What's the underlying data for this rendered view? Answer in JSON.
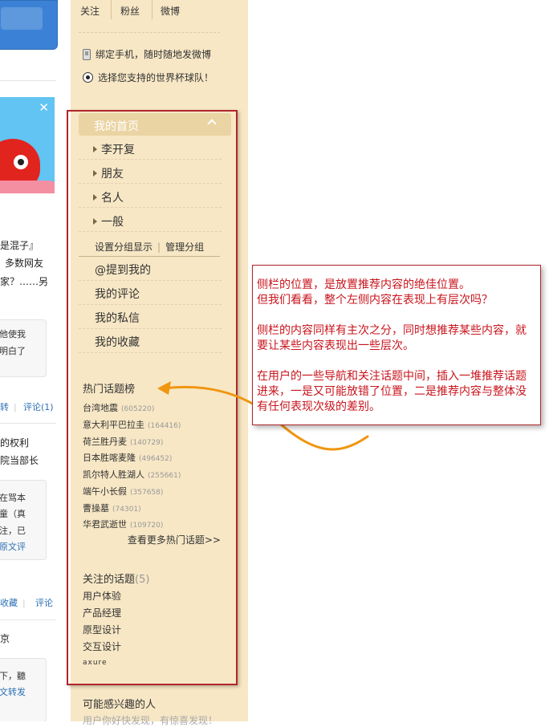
{
  "stats": [
    "关注",
    "粉丝",
    "微博"
  ],
  "promos": {
    "bind_phone": "绑定手机，随时随地发微博",
    "worldcup": "选择您支持的世界杯球队！"
  },
  "menu": {
    "home": "我的首页",
    "groups": [
      "李开复",
      "朋友",
      "名人",
      "一般"
    ],
    "group_settings": "设置分组显示",
    "manage_groups": "管理分组",
    "nav": [
      "@提到我的",
      "我的评论",
      "我的私信",
      "我的收藏"
    ]
  },
  "hot_topics": {
    "title": "热门话题榜",
    "items": [
      {
        "name": "台湾地震",
        "count": "(605220)"
      },
      {
        "name": "意大利平巴拉圭",
        "count": "(164416)"
      },
      {
        "name": "荷兰胜丹麦",
        "count": "(140729)"
      },
      {
        "name": "日本胜喀麦隆",
        "count": "(496452)"
      },
      {
        "name": "凯尔特人胜湖人",
        "count": "(255661)"
      },
      {
        "name": "端午小长假",
        "count": "(357658)"
      },
      {
        "name": "曹操墓",
        "count": "(74301)"
      },
      {
        "name": "华君武逝世",
        "count": "(109720)"
      }
    ],
    "more": "查看更多热门话题>>"
  },
  "followed_topics": {
    "title": "关注的话题",
    "count": "(5)",
    "items": [
      "用户体验",
      "产品经理",
      "原型设计",
      "交互设计",
      "axure"
    ]
  },
  "interest": {
    "title": "可能感兴趣的人",
    "cutoff": "用户你好快发现，有惊喜发现！"
  },
  "feed": {
    "frag1": "是混子』",
    "frag2": "多数网友",
    "frag3": "家？……另",
    "frag4": "他使我",
    "frag5": "明白了",
    "action1": "转",
    "action1b": "评论(1)",
    "frag6": "的权利",
    "frag7": "院当部长",
    "frag8": "在骂本",
    "frag9": "童（真",
    "frag10": "注，已",
    "frag11": "原文评",
    "action2a": "收藏",
    "action2b": "评论",
    "frag12": "京",
    "frag13": "下，聽",
    "frag14": "文转发"
  },
  "annotation": {
    "paragraphs": [
      "侧栏的位置，是放置推荐内容的绝佳位置。\n但我们看看，整个左侧内容在表现上有层次吗？",
      "侧栏的内容同样有主次之分，同时想推荐某些内容，就要让某些内容表现出一些层次。",
      "在用户的一些导航和关注话题中间，插入一堆推荐话题进来，一是又可能放错了位置，二是推荐内容与整体没有任何表现次级的差别。"
    ],
    "frame_color": "#b0262a",
    "text_color": "#c8141c",
    "arrow_color": "#f0960f"
  },
  "colors": {
    "sidebar_bg": "#f7e7c5",
    "home_highlight": "#ead4a3"
  }
}
